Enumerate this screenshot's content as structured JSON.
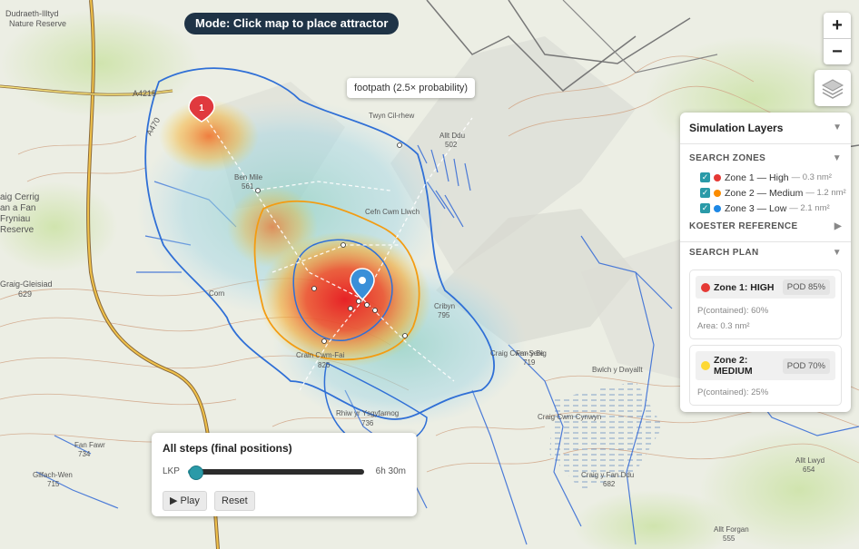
{
  "mode_banner": "Mode: Click map to place attractor",
  "tooltip": "footpath (2.5× probability)",
  "zoom": {
    "in_label": "+",
    "out_label": "−"
  },
  "map": {
    "labels": [
      "Dudraeth-Illtyd",
      "Nature Reserve",
      "A4215",
      "A470",
      "Twyn Cil-rhew",
      "Allt Ddu",
      "502",
      "Ben Mile",
      "561",
      "Cefn Cwm Llwch",
      "aig Cerrig",
      "an a Fan",
      "Fryniau",
      "Reserve",
      "Graig-Gleisiad",
      "629",
      "Corn",
      "Cribyn",
      "795",
      "Fan y Big",
      "719",
      "Craig Cwm-Sere",
      "Crain Cwm-Fai",
      "826",
      "Rhiw yr Ysgyfarnog",
      "736",
      "Bwlch y Dwyallt",
      "Craig Cwm Cynwyn",
      "Fan Fawr",
      "734",
      "Gilfach-Wen",
      "715",
      "Craig y Fan Ddu",
      "682",
      "Allt Lwyd",
      "654",
      "Allt Forgan",
      "555"
    ],
    "marker_number": "1"
  },
  "panel": {
    "title": "Simulation Layers",
    "search_zones_heading": "SEARCH ZONES",
    "zones": [
      {
        "label": "Zone 1 — High",
        "area": "— 0.3 nm²",
        "color": "#e53935",
        "checked": true
      },
      {
        "label": "Zone 2 — Medium",
        "area": "— 1.2 nm²",
        "color": "#fb8c00",
        "checked": true
      },
      {
        "label": "Zone 3 — Low",
        "area": "— 2.1 nm²",
        "color": "#1e88e5",
        "checked": true
      }
    ],
    "koester_heading": "KOESTER REFERENCE",
    "search_plan_heading": "SEARCH PLAN",
    "plan_cards": [
      {
        "title": "Zone 1: HIGH",
        "pod": "POD 85%",
        "contained": "P(contained): 60%",
        "area": "Area: 0.3 nm²",
        "color": "#e53935"
      },
      {
        "title": "Zone 2: MEDIUM",
        "pod": "POD 70%",
        "contained": "P(contained): 25%",
        "color": "#fdd835"
      }
    ]
  },
  "timeline": {
    "title": "All steps (final positions)",
    "start_label": "LKP",
    "end_label": "6h 30m",
    "progress": 0.04,
    "play_label": "▶ Play",
    "reset_label": "Reset"
  },
  "colors": {
    "accent": "#2a9aa8",
    "zone_outline": "#2f6fd6",
    "zone2_outline": "#f39c12"
  }
}
